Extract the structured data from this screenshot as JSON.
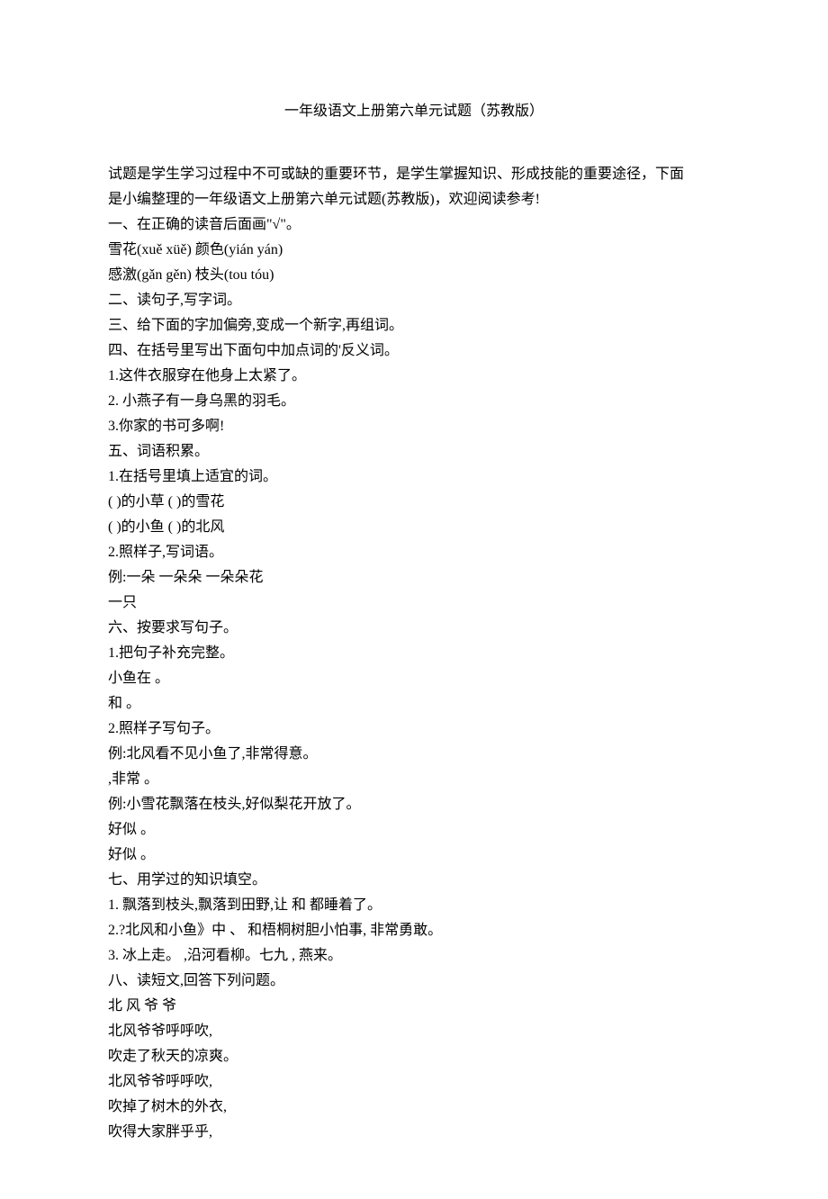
{
  "title": "一年级语文上册第六单元试题（苏教版）",
  "intro_line1": "试题是学生学习过程中不可或缺的重要环节，是学生掌握知识、形成技能的重要途径，下面",
  "intro_line2": "是小编整理的一年级语文上册第六单元试题(苏教版)，欢迎阅读参考!",
  "lines": [
    "一、在正确的读音后面画\"√\"。",
    "雪花(xuě xüě)  颜色(yián yán)",
    "感激(gǎn gěn)  枝头(tou tóu)",
    "二、读句子,写字词。",
    "三、给下面的字加偏旁,变成一个新字,再组词。",
    "四、在括号里写出下面句中加点词的'反义词。",
    "1.这件衣服穿在他身上太紧了。",
    "2.  小燕子有一身乌黑的羽毛。",
    "3.你家的书可多啊!",
    "五、词语积累。",
    "1.在括号里填上适宜的词。",
    "( )的小草  ( )的雪花",
    "( )的小鱼  ( )的北风",
    "2.照样子,写词语。",
    "例:一朵  一朵朵  一朵朵花",
    "一只",
    "六、按要求写句子。",
    "1.把句子补充完整。",
    "小鱼在  。",
    "和  。",
    "2.照样子写句子。",
    "例:北风看不见小鱼了,非常得意。",
    ",非常  。",
    "例:小雪花飘落在枝头,好似梨花开放了。",
    "好似  。",
    "好似  。",
    "七、用学过的知识填空。",
    "1.  飘落到枝头,飘落到田野,让  和  都睡着了。",
    "2.?北风和小鱼》中  、  和梧桐树胆小怕事,  非常勇敢。",
    "3.  冰上走。  ,沿河看柳。七九  ,  燕来。",
    "八、读短文,回答下列问题。",
    "北  风  爷  爷",
    "北风爷爷呼呼吹,",
    "吹走了秋天的凉爽。",
    "北风爷爷呼呼吹,",
    "吹掉了树木的外衣,",
    "吹得大家胖乎乎,"
  ]
}
